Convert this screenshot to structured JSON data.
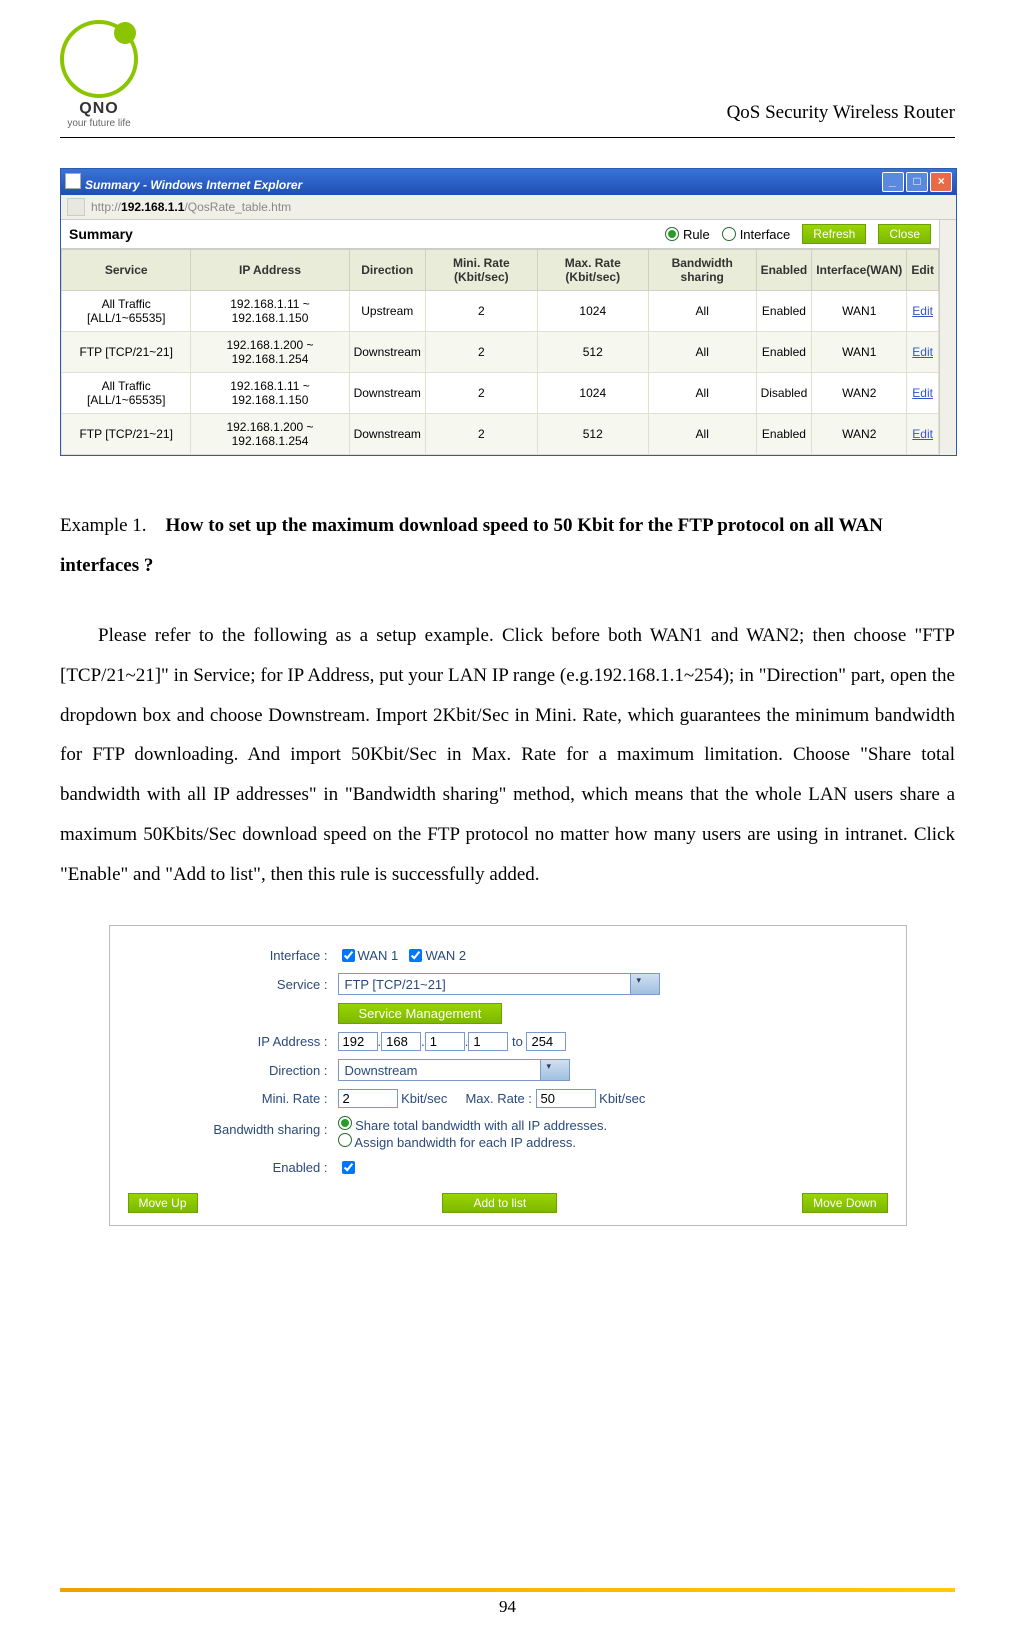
{
  "header": {
    "logo_text": "QNO",
    "logo_sub": "your future life",
    "doc_title": "QoS Security Wireless Router"
  },
  "browser": {
    "title": "Summary - Windows Internet Explorer",
    "url_bold": "192.168.1.1",
    "url_rest": "/QosRate_table.htm",
    "summary_label": "Summary",
    "rule_label": "Rule",
    "interface_label": "Interface",
    "refresh_btn": "Refresh",
    "close_btn": "Close"
  },
  "table": {
    "headers": [
      "Service",
      "IP Address",
      "Direction",
      "Mini. Rate (Kbit/sec)",
      "Max. Rate (Kbit/sec)",
      "Bandwidth sharing",
      "Enabled",
      "Interface(WAN)",
      "Edit"
    ],
    "rows": [
      {
        "service": "All Traffic [ALL/1~65535]",
        "ip": "192.168.1.11 ~ 192.168.1.150",
        "dir": "Upstream",
        "min": "2",
        "max": "1024",
        "share": "All",
        "enabled": "Enabled",
        "wan": "WAN1",
        "edit": "Edit"
      },
      {
        "service": "FTP [TCP/21~21]",
        "ip": "192.168.1.200 ~ 192.168.1.254",
        "dir": "Downstream",
        "min": "2",
        "max": "512",
        "share": "All",
        "enabled": "Enabled",
        "wan": "WAN1",
        "edit": "Edit"
      },
      {
        "service": "All Traffic [ALL/1~65535]",
        "ip": "192.168.1.11 ~ 192.168.1.150",
        "dir": "Downstream",
        "min": "2",
        "max": "1024",
        "share": "All",
        "enabled": "Disabled",
        "wan": "WAN2",
        "edit": "Edit"
      },
      {
        "service": "FTP [TCP/21~21]",
        "ip": "192.168.1.200 ~ 192.168.1.254",
        "dir": "Downstream",
        "min": "2",
        "max": "512",
        "share": "All",
        "enabled": "Enabled",
        "wan": "WAN2",
        "edit": "Edit"
      }
    ]
  },
  "example": {
    "prefix": "Example 1.",
    "title": "How to set up the maximum download speed to 50 Kbit for the FTP protocol on all WAN interfaces ?",
    "body": "Please refer to the following as a setup example. Click before both WAN1 and WAN2; then choose \"FTP [TCP/21~21]\" in Service; for IP Address, put your LAN IP range (e.g.192.168.1.1~254); in \"Direction\" part, open the dropdown box and choose Downstream. Import 2Kbit/Sec in Mini. Rate, which guarantees the minimum bandwidth for FTP downloading. And import 50Kbit/Sec in Max. Rate for a maximum limitation. Choose \"Share total bandwidth with all IP addresses\" in \"Bandwidth sharing\" method, which means that the whole LAN users share a maximum 50Kbits/Sec download speed on the FTP protocol no matter how many users are using in intranet. Click \"Enable\" and \"Add to list\", then this rule is successfully added."
  },
  "form": {
    "interface_label": "Interface :",
    "wan1": "WAN 1",
    "wan2": "WAN 2",
    "service_label": "Service :",
    "service_value": "FTP [TCP/21~21]",
    "svc_mgmt": "Service Management",
    "ip_label": "IP Address :",
    "ip1": "192",
    "ip2": "168",
    "ip3": "1",
    "ip4": "1",
    "ip_to": "to",
    "ip5": "254",
    "dir_label": "Direction :",
    "dir_value": "Downstream",
    "min_label": "Mini. Rate :",
    "min_val": "2",
    "unit": "Kbit/sec",
    "max_label": "Max. Rate :",
    "max_val": "50",
    "bw_label": "Bandwidth sharing :",
    "bw_opt1": "Share total bandwidth with all IP addresses.",
    "bw_opt2": "Assign bandwidth for each IP address.",
    "enabled_label": "Enabled :",
    "moveup": "Move Up",
    "addlist": "Add to list",
    "movedown": "Move Down"
  },
  "pagenum": "94"
}
